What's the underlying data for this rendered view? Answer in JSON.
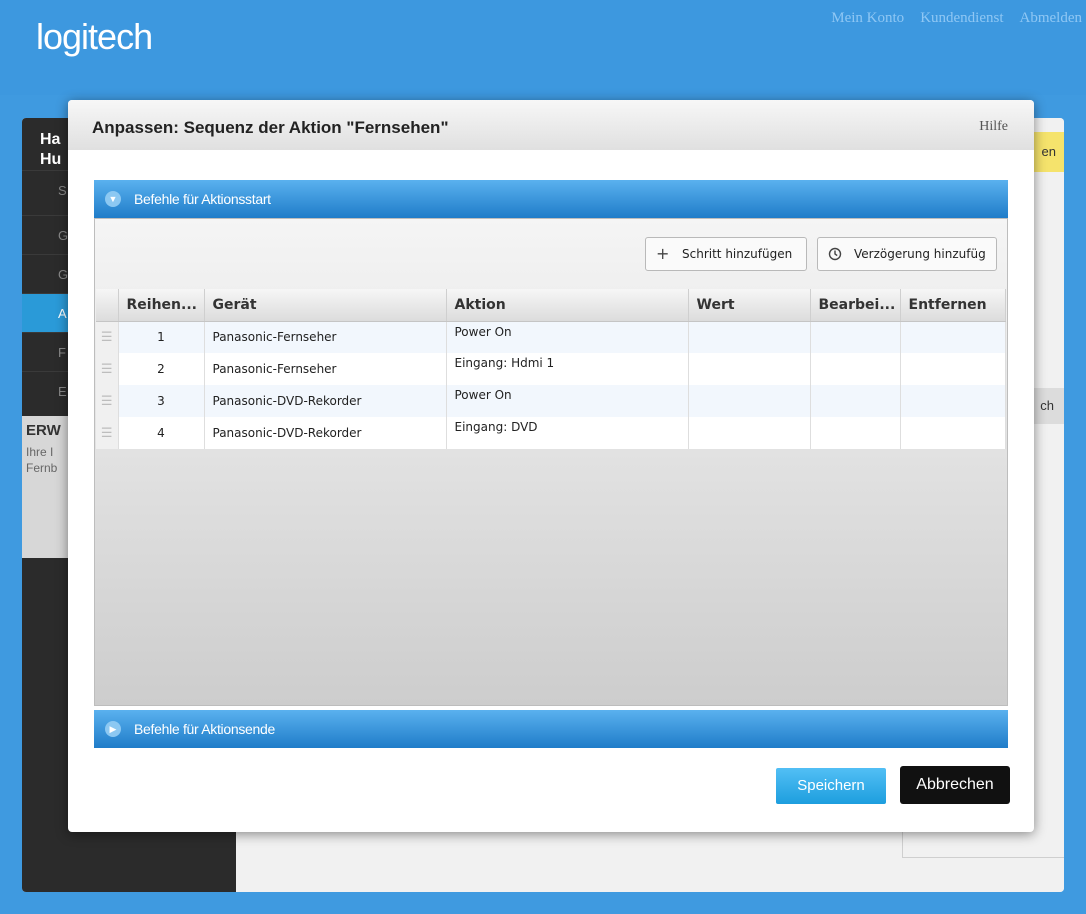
{
  "header": {
    "logo": "logitech",
    "links": [
      "Mein Konto",
      "Kundendienst",
      "Abmelden"
    ]
  },
  "background": {
    "sidebar_title": "Ha\nHu",
    "sidebar_items": [
      "S",
      "G",
      "G",
      "A",
      "F",
      "E"
    ],
    "ext_title": "ERW",
    "ext_sub": "Ihre I\nFernb",
    "right_banner": "en",
    "right_item": "ch"
  },
  "modal": {
    "title": "Anpassen: Sequenz der Aktion \"Fernsehen\"",
    "help": "Hilfe",
    "start_panel": "Befehle für Aktionsstart",
    "end_panel": "Befehle für Aktionsende",
    "add_step": "Schritt hinzufügen",
    "add_delay": "Verzögerung hinzufüg",
    "columns": [
      "Reihen...",
      "Gerät",
      "Aktion",
      "Wert",
      "Bearbei...",
      "Entfernen"
    ],
    "rows": [
      {
        "order": "1",
        "device": "Panasonic-Fernseher",
        "action": "Power On",
        "value": ""
      },
      {
        "order": "2",
        "device": "Panasonic-Fernseher",
        "action": "Eingang: Hdmi 1",
        "value": ""
      },
      {
        "order": "3",
        "device": "Panasonic-DVD-Rekorder",
        "action": "Power On",
        "value": ""
      },
      {
        "order": "4",
        "device": "Panasonic-DVD-Rekorder",
        "action": "Eingang: DVD",
        "value": ""
      }
    ],
    "save": "Speichern",
    "cancel": "Abbrechen"
  },
  "icons": {
    "plus": "plus-icon",
    "clock": "clock-icon",
    "expanded": "chevron-down-icon",
    "collapsed": "chevron-right-icon",
    "drag": "drag-handle-icon"
  }
}
